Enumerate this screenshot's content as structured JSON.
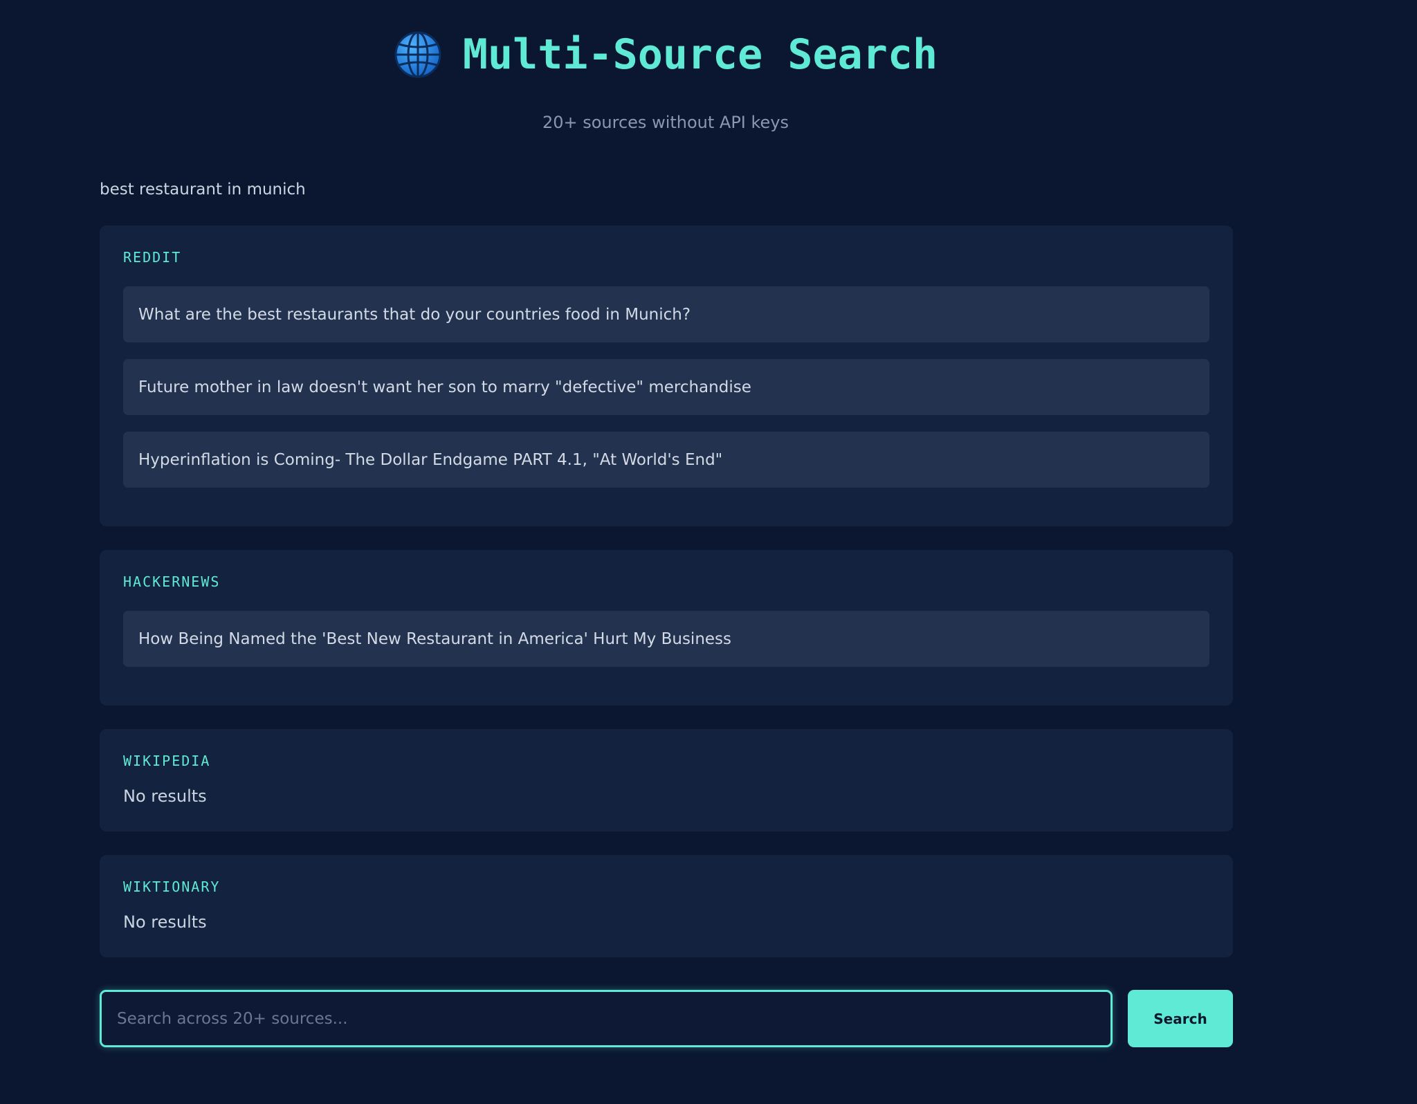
{
  "header": {
    "icon": "globe-icon",
    "title": "Multi-Source Search",
    "subtitle": "20+ sources without API keys"
  },
  "query_echo": "best restaurant in munich",
  "sources": [
    {
      "name": "REDDIT",
      "results": [
        "What are the best restaurants that do your countries food in Munich?",
        "Future mother in law doesn't want her son to marry \"defective\" merchandise",
        "Hyperinflation is Coming- The Dollar Endgame PART 4.1, \"At World's End\""
      ]
    },
    {
      "name": "HACKERNEWS",
      "results": [
        "How Being Named the 'Best New Restaurant in America' Hurt My Business"
      ]
    },
    {
      "name": "WIKIPEDIA",
      "no_results_text": "No results"
    },
    {
      "name": "WIKTIONARY",
      "no_results_text": "No results"
    }
  ],
  "search": {
    "placeholder": "Search across 20+ sources...",
    "value": "",
    "button_label": "Search"
  },
  "colors": {
    "background": "#0b1730",
    "card": "#13223f",
    "item": "#22324f",
    "accent": "#5eead4"
  }
}
